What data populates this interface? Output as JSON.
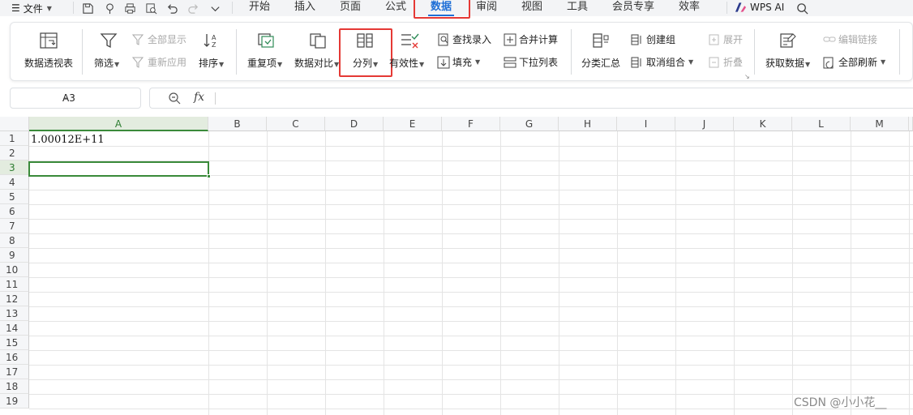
{
  "menubar": {
    "file_menu": "文件",
    "tabs": [
      "开始",
      "插入",
      "页面",
      "公式",
      "数据",
      "审阅",
      "视图",
      "工具",
      "会员专享",
      "效率"
    ],
    "active_tab": "数据",
    "wps_ai": "WPS AI"
  },
  "ribbon": {
    "pivot": "数据透视表",
    "filter": "筛选",
    "show_all": "全部显示",
    "reapply": "重新应用",
    "sort": "排序",
    "duplicates": "重复项",
    "compare": "数据对比",
    "split": "分列",
    "validity": "有效性",
    "find_entry": "查找录入",
    "fill": "填充",
    "merge_calc": "合并计算",
    "dropdown_list": "下拉列表",
    "subtotal": "分类汇总",
    "create_group": "创建组",
    "ungroup": "取消组合",
    "expand": "展开",
    "collapse": "折叠",
    "get_data": "获取数据",
    "edit_links": "编辑链接",
    "refresh_all": "全部刷新"
  },
  "formula_bar": {
    "name_box": "A3",
    "fx": "fx",
    "formula": ""
  },
  "sheet": {
    "columns": [
      "A",
      "B",
      "C",
      "D",
      "E",
      "F",
      "G",
      "H",
      "I",
      "J",
      "K",
      "L",
      "M"
    ],
    "rows": [
      "1",
      "2",
      "3",
      "4",
      "5",
      "6",
      "7",
      "8",
      "9",
      "10",
      "11",
      "12",
      "13",
      "14",
      "15",
      "16",
      "17",
      "18",
      "19"
    ],
    "selected_column": "A",
    "selected_row": "3",
    "cell_a1": "1.00012E+11"
  },
  "watermark": "CSDN @小小花__",
  "colors": {
    "accent": "#1f6fd6",
    "selection": "#3a8a3a",
    "highlight": "#e53935"
  }
}
